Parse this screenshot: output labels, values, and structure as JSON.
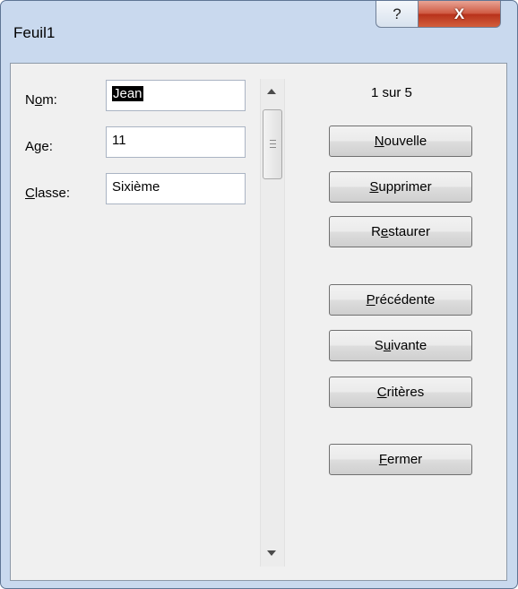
{
  "window": {
    "title": "Feuil1",
    "help_glyph": "?",
    "close_glyph": "X"
  },
  "fields": [
    {
      "label_pre": "N",
      "label_key": "o",
      "label_post": "m:",
      "value": "Jean"
    },
    {
      "label_pre": "A",
      "label_key": "g",
      "label_post": "e:",
      "value": "11"
    },
    {
      "label_pre": "",
      "label_key": "C",
      "label_post": "lasse:",
      "value": "Sixième"
    }
  ],
  "record_counter": "1 sur 5",
  "buttons": {
    "new": {
      "pre": "",
      "key": "N",
      "post": "ouvelle"
    },
    "delete": {
      "pre": "",
      "key": "S",
      "post": "upprimer"
    },
    "restore": {
      "pre": "R",
      "key": "e",
      "post": "staurer"
    },
    "previous": {
      "pre": "",
      "key": "P",
      "post": "récédente"
    },
    "next": {
      "pre": "S",
      "key": "u",
      "post": "ivante"
    },
    "criteria": {
      "pre": "",
      "key": "C",
      "post": "ritères"
    },
    "close": {
      "pre": "",
      "key": "F",
      "post": "ermer"
    }
  }
}
